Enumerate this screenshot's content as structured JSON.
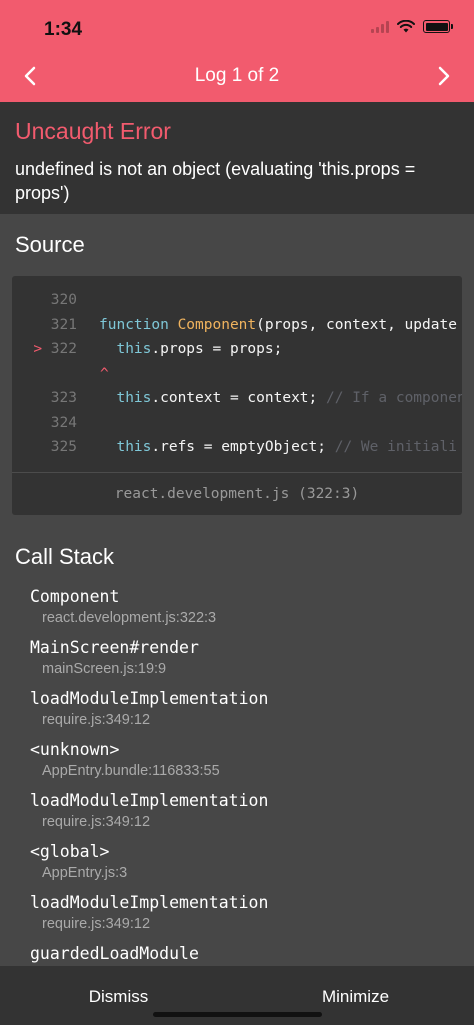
{
  "status_bar": {
    "time": "1:34"
  },
  "nav": {
    "title": "Log 1 of 2",
    "prev_icon": "chevron-left-icon",
    "next_icon": "chevron-right-icon"
  },
  "error": {
    "title": "Uncaught Error",
    "message": "undefined is not an object (evaluating 'this.props = props')"
  },
  "source": {
    "heading": "Source",
    "file": "react.development.js (322:3)",
    "marker": ">",
    "caret": "^",
    "lines": [
      {
        "number": "320",
        "tokens": []
      },
      {
        "number": "321",
        "tokens": [
          {
            "t": "function ",
            "c": "kw"
          },
          {
            "t": "Component",
            "c": "fn"
          },
          {
            "t": "(props, context, update",
            "c": ""
          }
        ]
      },
      {
        "number": "322",
        "tokens": [
          {
            "t": "  this",
            "c": "kw"
          },
          {
            "t": ".props = props;",
            "c": ""
          }
        ]
      },
      {
        "number": "323",
        "tokens": [
          {
            "t": "  this",
            "c": "kw"
          },
          {
            "t": ".context = context; ",
            "c": ""
          },
          {
            "t": "// If a componen",
            "c": "cm"
          }
        ]
      },
      {
        "number": "324",
        "tokens": []
      },
      {
        "number": "325",
        "tokens": [
          {
            "t": "  this",
            "c": "kw"
          },
          {
            "t": ".refs = emptyObject; ",
            "c": ""
          },
          {
            "t": "// We initiali",
            "c": "cm"
          }
        ]
      }
    ]
  },
  "call_stack": {
    "heading": "Call Stack",
    "frames": [
      {
        "name": "Component",
        "location": "react.development.js:322:3"
      },
      {
        "name": "MainScreen#render",
        "location": "mainScreen.js:19:9"
      },
      {
        "name": "loadModuleImplementation",
        "location": "require.js:349:12"
      },
      {
        "name": "<unknown>",
        "location": "AppEntry.bundle:116833:55"
      },
      {
        "name": "loadModuleImplementation",
        "location": "require.js:349:12"
      },
      {
        "name": "<global>",
        "location": "AppEntry.js:3"
      },
      {
        "name": "loadModuleImplementation",
        "location": "require.js:349:12"
      },
      {
        "name": "guardedLoadModule",
        "location": ""
      }
    ]
  },
  "footer": {
    "dismiss_label": "Dismiss",
    "minimize_label": "Minimize"
  },
  "colors": {
    "accent": "#f25b6e",
    "panel": "#333333",
    "background": "#474747"
  }
}
